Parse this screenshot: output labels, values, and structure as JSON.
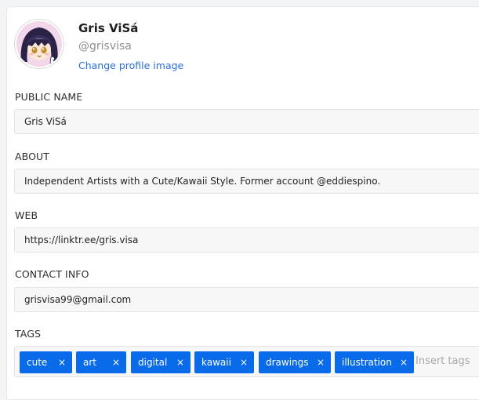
{
  "profile": {
    "name": "Gris ViSá",
    "handle": "@grisvisa",
    "change_image_label": "Change profile image"
  },
  "fields": {
    "public_name": {
      "label": "PUBLIC NAME",
      "value": "Gris ViSá"
    },
    "about": {
      "label": "ABOUT",
      "value": "Independent Artists with a Cute/Kawaii Style. Former account @eddiespino."
    },
    "web": {
      "label": "WEB",
      "value": "https://linktr.ee/gris.visa"
    },
    "contact": {
      "label": "CONTACT INFO",
      "value": "grisvisa99@gmail.com"
    }
  },
  "tags": {
    "label": "TAGS",
    "items": [
      "cute",
      "art",
      "digital",
      "kawaii",
      "drawings",
      "illustration"
    ],
    "remove_glyph": "×",
    "placeholder": "Insert tags"
  },
  "colors": {
    "accent": "#0a6bea",
    "link": "#2a6fd8"
  },
  "icons": {
    "avatar": "anime-avatar-illustration",
    "remove": "close-icon"
  }
}
